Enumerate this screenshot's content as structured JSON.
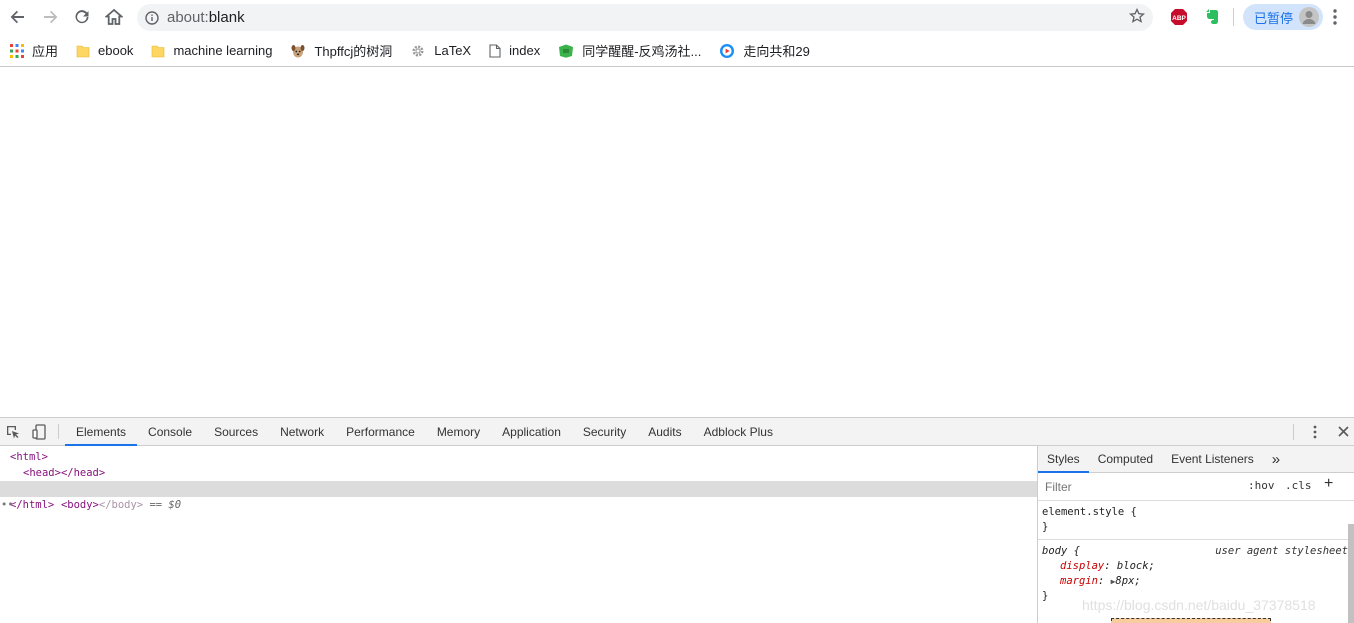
{
  "toolbar": {
    "back": "back",
    "forward": "forward",
    "reload": "reload",
    "home": "home",
    "url_scheme": "about:",
    "url_rest": "blank",
    "profile_status": "已暂停"
  },
  "bookmarks": [
    {
      "label": "应用",
      "icon": "apps-grid-icon"
    },
    {
      "label": "ebook",
      "icon": "folder-icon"
    },
    {
      "label": "machine learning",
      "icon": "folder-icon"
    },
    {
      "label": "Thpffcj的树洞",
      "icon": "dog-icon"
    },
    {
      "label": "LaTeX",
      "icon": "gear-icon"
    },
    {
      "label": "index",
      "icon": "page-icon"
    },
    {
      "label": "同学醒醒-反鸡汤社...",
      "icon": "green-flag-icon"
    },
    {
      "label": "走向共和29",
      "icon": "play-icon"
    }
  ],
  "devtools": {
    "tabs": [
      "Elements",
      "Console",
      "Sources",
      "Network",
      "Performance",
      "Memory",
      "Application",
      "Security",
      "Audits",
      "Adblock Plus"
    ],
    "active_tab": "Elements",
    "dom": {
      "line1": "<html>",
      "line2_open": "<head>",
      "line2_close": "</head>",
      "line3_open": "<body>",
      "line3_close": "</body>",
      "line3_eq": " == $0",
      "line4": "</html>",
      "dots": "••"
    },
    "styles": {
      "tabs": [
        "Styles",
        "Computed",
        "Event Listeners"
      ],
      "more": "»",
      "filter_placeholder": "Filter",
      "hov": ":hov",
      "cls": ".cls",
      "plus": "+",
      "element_style_selector": "element.style {",
      "close_brace": "}",
      "body_selector": "body {",
      "body_source": "user agent stylesheet",
      "prop1_name": "display",
      "prop1_value": "block;",
      "prop2_name": "margin",
      "prop2_value": "8px;"
    }
  },
  "watermark": "https://blog.csdn.net/baidu_37378518"
}
